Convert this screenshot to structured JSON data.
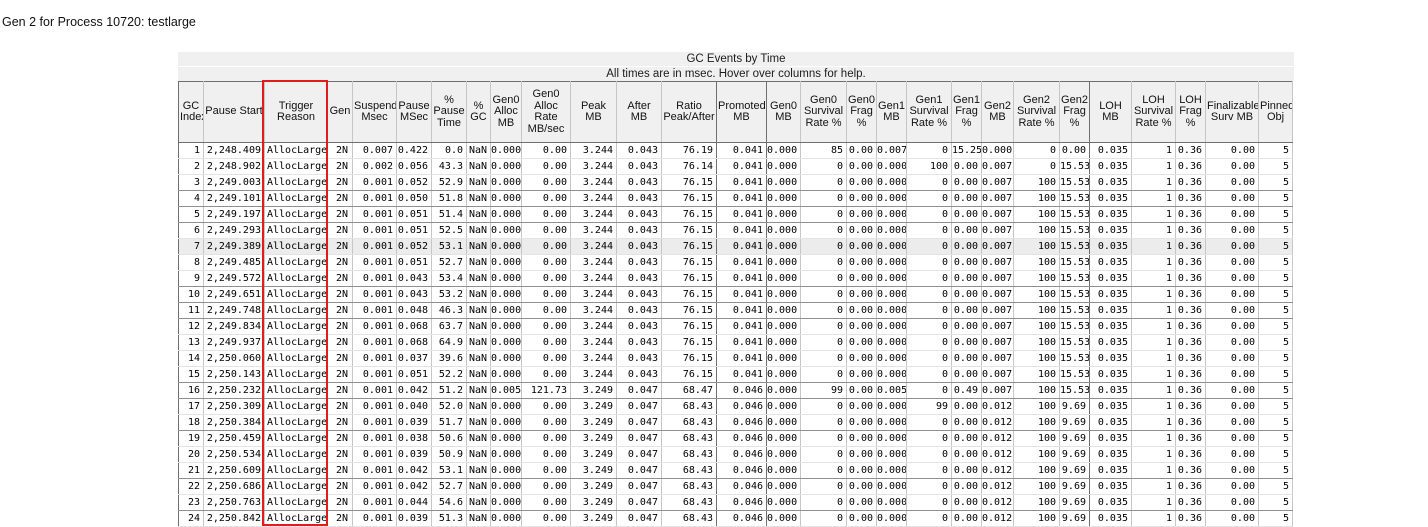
{
  "page_title": "Gen 2 for Process 10720: testlarge",
  "table": {
    "title": "GC Events by Time",
    "subtitle": "All times are in msec. Hover over columns for help.",
    "highlighted_column": "Trigger Reason",
    "highlight_color": "#e31b1b",
    "selected_gc_index": "7",
    "columns": [
      "GC Index",
      "Pause Start",
      "Trigger Reason",
      "Gen",
      "Suspend Msec",
      "Pause MSec",
      "% Pause Time",
      "% GC",
      "Gen0 Alloc MB",
      "Gen0 Alloc Rate MB/sec",
      "Peak MB",
      "After MB",
      "Ratio Peak/After",
      "Promoted MB",
      "Gen0 MB",
      "Gen0 Survival Rate %",
      "Gen0 Frag %",
      "Gen1 MB",
      "Gen1 Survival Rate %",
      "Gen1 Frag %",
      "Gen2 MB",
      "Gen2 Survival Rate %",
      "Gen2 Frag %",
      "LOH MB",
      "LOH Survival Rate %",
      "LOH Frag %",
      "Finalizable Surv MB",
      "Pinned Obj"
    ],
    "rows": [
      [
        "1",
        "2,248.409",
        "AllocLarge",
        "2N",
        "0.007",
        "0.422",
        "0.0",
        "NaN",
        "0.000",
        "0.00",
        "3.244",
        "0.043",
        "76.19",
        "0.041",
        "0.000",
        "85",
        "0.00",
        "0.007",
        "0",
        "15.25",
        "0.000",
        "0",
        "0.00",
        "0.035",
        "1",
        "0.36",
        "0.00",
        "5"
      ],
      [
        "2",
        "2,248.902",
        "AllocLarge",
        "2N",
        "0.002",
        "0.056",
        "43.3",
        "NaN",
        "0.000",
        "0.00",
        "3.244",
        "0.043",
        "76.14",
        "0.041",
        "0.000",
        "0",
        "0.00",
        "0.000",
        "100",
        "0.00",
        "0.007",
        "0",
        "15.53",
        "0.035",
        "1",
        "0.36",
        "0.00",
        "5"
      ],
      [
        "3",
        "2,249.003",
        "AllocLarge",
        "2N",
        "0.001",
        "0.052",
        "52.9",
        "NaN",
        "0.000",
        "0.00",
        "3.244",
        "0.043",
        "76.15",
        "0.041",
        "0.000",
        "0",
        "0.00",
        "0.000",
        "0",
        "0.00",
        "0.007",
        "100",
        "15.53",
        "0.035",
        "1",
        "0.36",
        "0.00",
        "5"
      ],
      [
        "4",
        "2,249.101",
        "AllocLarge",
        "2N",
        "0.001",
        "0.050",
        "51.8",
        "NaN",
        "0.000",
        "0.00",
        "3.244",
        "0.043",
        "76.15",
        "0.041",
        "0.000",
        "0",
        "0.00",
        "0.000",
        "0",
        "0.00",
        "0.007",
        "100",
        "15.53",
        "0.035",
        "1",
        "0.36",
        "0.00",
        "5"
      ],
      [
        "5",
        "2,249.197",
        "AllocLarge",
        "2N",
        "0.001",
        "0.051",
        "51.4",
        "NaN",
        "0.000",
        "0.00",
        "3.244",
        "0.043",
        "76.15",
        "0.041",
        "0.000",
        "0",
        "0.00",
        "0.000",
        "0",
        "0.00",
        "0.007",
        "100",
        "15.53",
        "0.035",
        "1",
        "0.36",
        "0.00",
        "5"
      ],
      [
        "6",
        "2,249.293",
        "AllocLarge",
        "2N",
        "0.001",
        "0.051",
        "52.5",
        "NaN",
        "0.000",
        "0.00",
        "3.244",
        "0.043",
        "76.15",
        "0.041",
        "0.000",
        "0",
        "0.00",
        "0.000",
        "0",
        "0.00",
        "0.007",
        "100",
        "15.53",
        "0.035",
        "1",
        "0.36",
        "0.00",
        "5"
      ],
      [
        "7",
        "2,249.389",
        "AllocLarge",
        "2N",
        "0.001",
        "0.052",
        "53.1",
        "NaN",
        "0.000",
        "0.00",
        "3.244",
        "0.043",
        "76.15",
        "0.041",
        "0.000",
        "0",
        "0.00",
        "0.000",
        "0",
        "0.00",
        "0.007",
        "100",
        "15.53",
        "0.035",
        "1",
        "0.36",
        "0.00",
        "5"
      ],
      [
        "8",
        "2,249.485",
        "AllocLarge",
        "2N",
        "0.001",
        "0.051",
        "52.7",
        "NaN",
        "0.000",
        "0.00",
        "3.244",
        "0.043",
        "76.15",
        "0.041",
        "0.000",
        "0",
        "0.00",
        "0.000",
        "0",
        "0.00",
        "0.007",
        "100",
        "15.53",
        "0.035",
        "1",
        "0.36",
        "0.00",
        "5"
      ],
      [
        "9",
        "2,249.572",
        "AllocLarge",
        "2N",
        "0.001",
        "0.043",
        "53.4",
        "NaN",
        "0.000",
        "0.00",
        "3.244",
        "0.043",
        "76.15",
        "0.041",
        "0.000",
        "0",
        "0.00",
        "0.000",
        "0",
        "0.00",
        "0.007",
        "100",
        "15.53",
        "0.035",
        "1",
        "0.36",
        "0.00",
        "5"
      ],
      [
        "10",
        "2,249.651",
        "AllocLarge",
        "2N",
        "0.001",
        "0.043",
        "53.2",
        "NaN",
        "0.000",
        "0.00",
        "3.244",
        "0.043",
        "76.15",
        "0.041",
        "0.000",
        "0",
        "0.00",
        "0.000",
        "0",
        "0.00",
        "0.007",
        "100",
        "15.53",
        "0.035",
        "1",
        "0.36",
        "0.00",
        "5"
      ],
      [
        "11",
        "2,249.748",
        "AllocLarge",
        "2N",
        "0.001",
        "0.048",
        "46.3",
        "NaN",
        "0.000",
        "0.00",
        "3.244",
        "0.043",
        "76.15",
        "0.041",
        "0.000",
        "0",
        "0.00",
        "0.000",
        "0",
        "0.00",
        "0.007",
        "100",
        "15.53",
        "0.035",
        "1",
        "0.36",
        "0.00",
        "5"
      ],
      [
        "12",
        "2,249.834",
        "AllocLarge",
        "2N",
        "0.001",
        "0.068",
        "63.7",
        "NaN",
        "0.000",
        "0.00",
        "3.244",
        "0.043",
        "76.15",
        "0.041",
        "0.000",
        "0",
        "0.00",
        "0.000",
        "0",
        "0.00",
        "0.007",
        "100",
        "15.53",
        "0.035",
        "1",
        "0.36",
        "0.00",
        "5"
      ],
      [
        "13",
        "2,249.937",
        "AllocLarge",
        "2N",
        "0.001",
        "0.068",
        "64.9",
        "NaN",
        "0.000",
        "0.00",
        "3.244",
        "0.043",
        "76.15",
        "0.041",
        "0.000",
        "0",
        "0.00",
        "0.000",
        "0",
        "0.00",
        "0.007",
        "100",
        "15.53",
        "0.035",
        "1",
        "0.36",
        "0.00",
        "5"
      ],
      [
        "14",
        "2,250.060",
        "AllocLarge",
        "2N",
        "0.001",
        "0.037",
        "39.6",
        "NaN",
        "0.000",
        "0.00",
        "3.244",
        "0.043",
        "76.15",
        "0.041",
        "0.000",
        "0",
        "0.00",
        "0.000",
        "0",
        "0.00",
        "0.007",
        "100",
        "15.53",
        "0.035",
        "1",
        "0.36",
        "0.00",
        "5"
      ],
      [
        "15",
        "2,250.143",
        "AllocLarge",
        "2N",
        "0.001",
        "0.051",
        "52.2",
        "NaN",
        "0.000",
        "0.00",
        "3.244",
        "0.043",
        "76.15",
        "0.041",
        "0.000",
        "0",
        "0.00",
        "0.000",
        "0",
        "0.00",
        "0.007",
        "100",
        "15.53",
        "0.035",
        "1",
        "0.36",
        "0.00",
        "5"
      ],
      [
        "16",
        "2,250.232",
        "AllocLarge",
        "2N",
        "0.001",
        "0.042",
        "51.2",
        "NaN",
        "0.005",
        "121.73",
        "3.249",
        "0.047",
        "68.47",
        "0.046",
        "0.000",
        "99",
        "0.00",
        "0.005",
        "0",
        "0.49",
        "0.007",
        "100",
        "15.53",
        "0.035",
        "1",
        "0.36",
        "0.00",
        "5"
      ],
      [
        "17",
        "2,250.309",
        "AllocLarge",
        "2N",
        "0.001",
        "0.040",
        "52.0",
        "NaN",
        "0.000",
        "0.00",
        "3.249",
        "0.047",
        "68.43",
        "0.046",
        "0.000",
        "0",
        "0.00",
        "0.000",
        "99",
        "0.00",
        "0.012",
        "100",
        "9.69",
        "0.035",
        "1",
        "0.36",
        "0.00",
        "5"
      ],
      [
        "18",
        "2,250.384",
        "AllocLarge",
        "2N",
        "0.001",
        "0.039",
        "51.7",
        "NaN",
        "0.000",
        "0.00",
        "3.249",
        "0.047",
        "68.43",
        "0.046",
        "0.000",
        "0",
        "0.00",
        "0.000",
        "0",
        "0.00",
        "0.012",
        "100",
        "9.69",
        "0.035",
        "1",
        "0.36",
        "0.00",
        "5"
      ],
      [
        "19",
        "2,250.459",
        "AllocLarge",
        "2N",
        "0.001",
        "0.038",
        "50.6",
        "NaN",
        "0.000",
        "0.00",
        "3.249",
        "0.047",
        "68.43",
        "0.046",
        "0.000",
        "0",
        "0.00",
        "0.000",
        "0",
        "0.00",
        "0.012",
        "100",
        "9.69",
        "0.035",
        "1",
        "0.36",
        "0.00",
        "5"
      ],
      [
        "20",
        "2,250.534",
        "AllocLarge",
        "2N",
        "0.001",
        "0.039",
        "50.9",
        "NaN",
        "0.000",
        "0.00",
        "3.249",
        "0.047",
        "68.43",
        "0.046",
        "0.000",
        "0",
        "0.00",
        "0.000",
        "0",
        "0.00",
        "0.012",
        "100",
        "9.69",
        "0.035",
        "1",
        "0.36",
        "0.00",
        "5"
      ],
      [
        "21",
        "2,250.609",
        "AllocLarge",
        "2N",
        "0.001",
        "0.042",
        "53.1",
        "NaN",
        "0.000",
        "0.00",
        "3.249",
        "0.047",
        "68.43",
        "0.046",
        "0.000",
        "0",
        "0.00",
        "0.000",
        "0",
        "0.00",
        "0.012",
        "100",
        "9.69",
        "0.035",
        "1",
        "0.36",
        "0.00",
        "5"
      ],
      [
        "22",
        "2,250.686",
        "AllocLarge",
        "2N",
        "0.001",
        "0.042",
        "52.7",
        "NaN",
        "0.000",
        "0.00",
        "3.249",
        "0.047",
        "68.43",
        "0.046",
        "0.000",
        "0",
        "0.00",
        "0.000",
        "0",
        "0.00",
        "0.012",
        "100",
        "9.69",
        "0.035",
        "1",
        "0.36",
        "0.00",
        "5"
      ],
      [
        "23",
        "2,250.763",
        "AllocLarge",
        "2N",
        "0.001",
        "0.044",
        "54.6",
        "NaN",
        "0.000",
        "0.00",
        "3.249",
        "0.047",
        "68.43",
        "0.046",
        "0.000",
        "0",
        "0.00",
        "0.000",
        "0",
        "0.00",
        "0.012",
        "100",
        "9.69",
        "0.035",
        "1",
        "0.36",
        "0.00",
        "5"
      ],
      [
        "24",
        "2,250.842",
        "AllocLarge",
        "2N",
        "0.001",
        "0.039",
        "51.3",
        "NaN",
        "0.000",
        "0.00",
        "3.249",
        "0.047",
        "68.43",
        "0.046",
        "0.000",
        "0",
        "0.00",
        "0.000",
        "0",
        "0.00",
        "0.012",
        "100",
        "9.69",
        "0.035",
        "1",
        "0.36",
        "0.00",
        "5"
      ]
    ]
  }
}
